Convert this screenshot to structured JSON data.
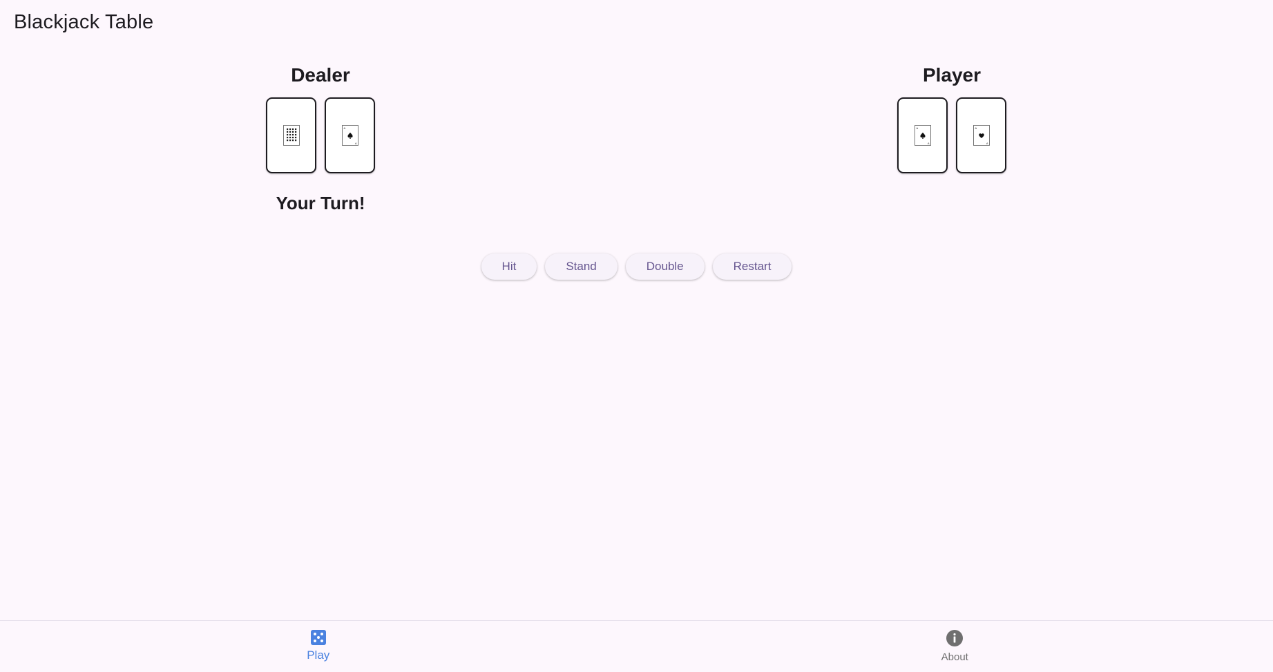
{
  "app": {
    "title": "Blackjack Table"
  },
  "dealer": {
    "title": "Dealer",
    "cards": [
      {
        "icon": "card-face-ten-pips-icon"
      },
      {
        "icon": "card-ace-of-spades-icon"
      }
    ]
  },
  "player": {
    "title": "Player",
    "cards": [
      {
        "icon": "card-ace-of-spades-icon"
      },
      {
        "icon": "card-ace-of-hearts-icon"
      }
    ]
  },
  "status": "Your Turn!",
  "actions": {
    "hit": "Hit",
    "stand": "Stand",
    "double": "Double",
    "restart": "Restart"
  },
  "nav": {
    "play": {
      "label": "Play",
      "icon": "dice-icon"
    },
    "about": {
      "label": "About",
      "icon": "info-icon"
    }
  },
  "colors": {
    "background": "#fdf7fd",
    "button_text": "#65558f",
    "nav_active": "#4a82e0",
    "nav_inactive": "#6f6f6f"
  }
}
